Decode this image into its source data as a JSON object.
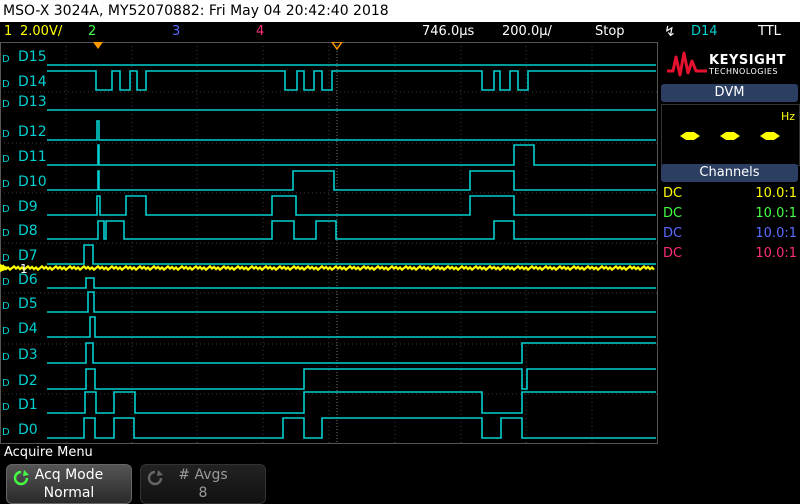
{
  "title": "MSO-X 3024A, MY52070882: Fri May 04 20:42:40 2018",
  "status": {
    "ch1_num": "1",
    "ch1_scale": "2.00V/",
    "ch2_num": "2",
    "ch3_num": "3",
    "ch4_num": "4",
    "time_delay": "746.0µs",
    "time_scale": "200.0µ/",
    "run_state": "Stop",
    "trigger_source": "D14",
    "trigger_level": "TTL"
  },
  "colors": {
    "ch1": "#ffff00",
    "ch2": "#44ff44",
    "ch3": "#5b6bff",
    "ch4": "#ff2e7a",
    "digital": "#00d0d0",
    "orange": "#ff9900",
    "panel": "#2c3f63"
  },
  "digital_labels": [
    "D15",
    "D14",
    "D13",
    "D12",
    "D11",
    "D10",
    "D9",
    "D8",
    "D7",
    "D6",
    "D5",
    "D4",
    "D3",
    "D2",
    "D1",
    "D0"
  ],
  "analog_marker": "1",
  "right_panel": {
    "brand": "KEYSIGHT",
    "brand_sub": "TECHNOLOGIES",
    "dvm_title": "DVM",
    "dvm_unit": "Hz",
    "channels_title": "Channels",
    "channels": [
      {
        "coupling": "DC",
        "probe": "10.0:1",
        "color": "#ffff00"
      },
      {
        "coupling": "DC",
        "probe": "10.0:1",
        "color": "#44ff44"
      },
      {
        "coupling": "DC",
        "probe": "10.0:1",
        "color": "#5b6bff"
      },
      {
        "coupling": "DC",
        "probe": "10.0:1",
        "color": "#ff2e7a"
      }
    ]
  },
  "menu": {
    "title": "Acquire Menu",
    "softkeys": [
      {
        "label": "Acq Mode",
        "value": "Normal"
      },
      {
        "label": "# Avgs",
        "value": "8"
      }
    ]
  }
}
